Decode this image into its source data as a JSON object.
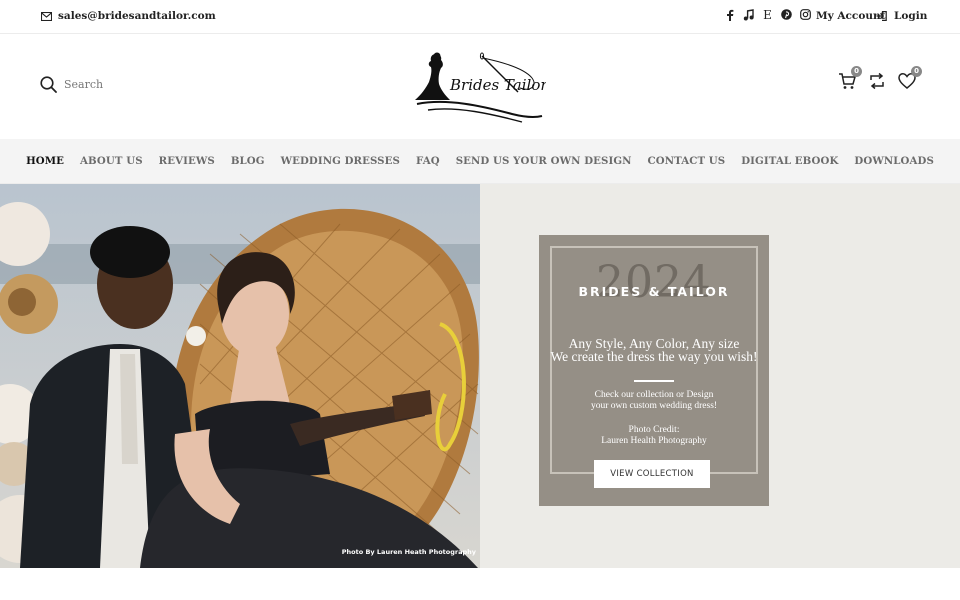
{
  "topbar": {
    "email": "sales@bridesandtailor.com",
    "socials": [
      "facebook-icon",
      "tiktok-icon",
      "etsy-icon",
      "pinterest-icon",
      "instagram-icon"
    ],
    "etsy_glyph": "E",
    "my_account": "My Account",
    "login": "Login"
  },
  "header": {
    "search_placeholder": "Search",
    "logo_text": "Brides Tailor",
    "cart_count": "0",
    "wishlist_count": "0"
  },
  "nav": {
    "items": [
      "HOME",
      "ABOUT US",
      "REVIEWS",
      "BLOG",
      "WEDDING DRESSES",
      "FAQ",
      "SEND US YOUR OWN DESIGN",
      "CONTACT US",
      "DIGITAL EBOOK",
      "DOWNLOADS"
    ]
  },
  "hero": {
    "photo_credit": "Photo By Lauren Heath Photography",
    "year": "2024",
    "brand": "BRIDES & TAILOR",
    "tagline_1": "Any Style, Any Color, Any size",
    "tagline_2": "We create the dress the way you wish!",
    "check_1": "Check our collection or Design",
    "check_2": "your own custom wedding dress!",
    "credit_label": "Photo Credit:",
    "credit_name": "Lauren Health Photography",
    "button": "VIEW COLLECTION"
  },
  "colors": {
    "promo_bg": "#958f86",
    "hero_bg": "#ecebe7",
    "nav_bg": "#f4f4f4",
    "badge": "#888888"
  }
}
